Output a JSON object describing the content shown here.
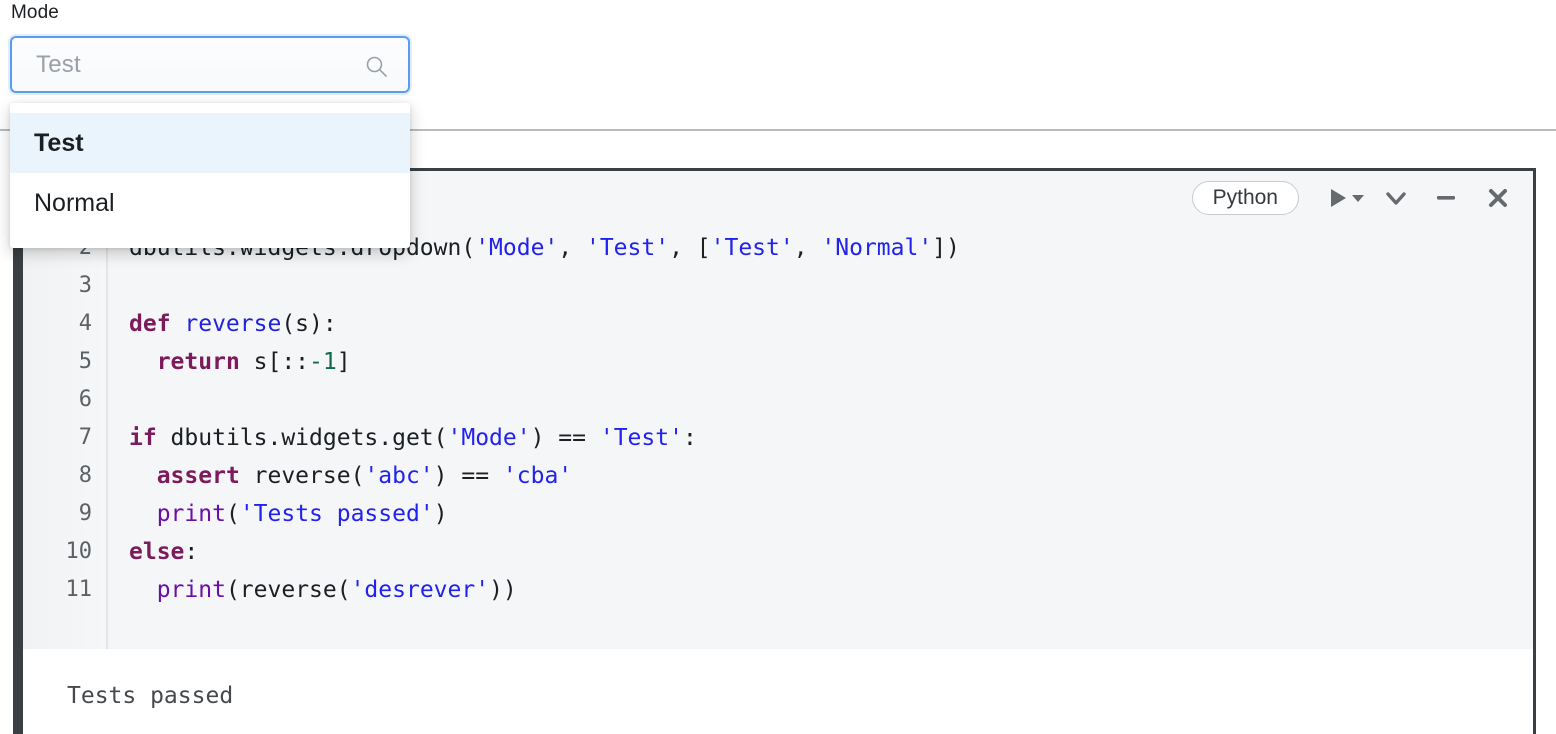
{
  "widget": {
    "label": "Mode",
    "value": "Test",
    "placeholder": "Test",
    "search_icon": "search-icon",
    "options": [
      {
        "label": "Test",
        "selected": true
      },
      {
        "label": "Normal",
        "selected": false
      }
    ]
  },
  "cell": {
    "language": "Python",
    "toolbar_icons": [
      "run-icon",
      "run-dropdown-caret-icon",
      "chevron-down-icon",
      "minimize-icon",
      "close-icon"
    ],
    "line_numbers": [
      "2",
      "3",
      "4",
      "5",
      "6",
      "7",
      "8",
      "9",
      "10",
      "11"
    ],
    "code_lines": [
      {
        "n": "2",
        "tokens": [
          {
            "t": "dbutils.widgets.dropdown(",
            "c": "pn"
          },
          {
            "t": "'Mode'",
            "c": "str"
          },
          {
            "t": ", ",
            "c": "pn"
          },
          {
            "t": "'Test'",
            "c": "str"
          },
          {
            "t": ", [",
            "c": "pn"
          },
          {
            "t": "'Test'",
            "c": "str"
          },
          {
            "t": ", ",
            "c": "pn"
          },
          {
            "t": "'Normal'",
            "c": "str"
          },
          {
            "t": "])",
            "c": "pn"
          }
        ]
      },
      {
        "n": "3",
        "tokens": []
      },
      {
        "n": "4",
        "tokens": [
          {
            "t": "def ",
            "c": "kw"
          },
          {
            "t": "reverse",
            "c": "fn"
          },
          {
            "t": "(s):",
            "c": "pn"
          }
        ]
      },
      {
        "n": "5",
        "tokens": [
          {
            "t": "  ",
            "c": "pn"
          },
          {
            "t": "return",
            "c": "kw"
          },
          {
            "t": " s[::",
            "c": "pn"
          },
          {
            "t": "-1",
            "c": "num"
          },
          {
            "t": "]",
            "c": "pn"
          }
        ]
      },
      {
        "n": "6",
        "tokens": []
      },
      {
        "n": "7",
        "tokens": [
          {
            "t": "if",
            "c": "kw"
          },
          {
            "t": " dbutils.widgets.get(",
            "c": "pn"
          },
          {
            "t": "'Mode'",
            "c": "str"
          },
          {
            "t": ") == ",
            "c": "pn"
          },
          {
            "t": "'Test'",
            "c": "str"
          },
          {
            "t": ":",
            "c": "pn"
          }
        ]
      },
      {
        "n": "8",
        "tokens": [
          {
            "t": "  ",
            "c": "pn"
          },
          {
            "t": "assert",
            "c": "kw"
          },
          {
            "t": " reverse(",
            "c": "pn"
          },
          {
            "t": "'abc'",
            "c": "str"
          },
          {
            "t": ") == ",
            "c": "pn"
          },
          {
            "t": "'cba'",
            "c": "str"
          }
        ]
      },
      {
        "n": "9",
        "tokens": [
          {
            "t": "  ",
            "c": "pn"
          },
          {
            "t": "print",
            "c": "bi"
          },
          {
            "t": "(",
            "c": "pn"
          },
          {
            "t": "'Tests passed'",
            "c": "str"
          },
          {
            "t": ")",
            "c": "pn"
          }
        ]
      },
      {
        "n": "10",
        "tokens": [
          {
            "t": "else",
            "c": "kw"
          },
          {
            "t": ":",
            "c": "pn"
          }
        ]
      },
      {
        "n": "11",
        "tokens": [
          {
            "t": "  ",
            "c": "pn"
          },
          {
            "t": "print",
            "c": "bi"
          },
          {
            "t": "(reverse(",
            "c": "pn"
          },
          {
            "t": "'desrever'",
            "c": "str"
          },
          {
            "t": "))",
            "c": "pn"
          }
        ]
      }
    ],
    "output": "Tests passed"
  },
  "colors": {
    "accent_blue": "#5a9cf0",
    "highlight_blue": "#eaf4fd",
    "cell_bar": "#3a3f44",
    "editor_bg": "#f5f6f7",
    "keyword": "#7b1b5c",
    "string": "#2222ee",
    "function": "#2222dd",
    "builtin": "#6a0dad",
    "number": "#106a4a"
  }
}
